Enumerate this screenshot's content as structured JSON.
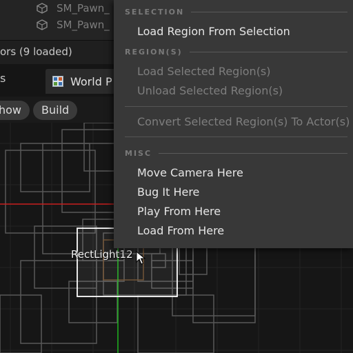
{
  "outliner": {
    "rows": [
      {
        "label": "SM_Pawn_",
        "icon": "static-mesh-icon"
      },
      {
        "label": "SM_Pawn_",
        "icon": "static-mesh-icon"
      }
    ]
  },
  "panel": {
    "title": "ors (9 loaded)"
  },
  "tabs": {
    "left_label": "s",
    "world_label": "World P"
  },
  "toolbar": {
    "show_label": "how",
    "build_label": "Build"
  },
  "viewport": {
    "actor_label": "RectLight12"
  },
  "context_menu": {
    "sections": {
      "selection": "SELECTION",
      "regions": "REGION(S)",
      "misc": "MISC"
    },
    "items": {
      "load_region_from_selection": "Load Region From Selection",
      "load_selected_regions": "Load Selected Region(s)",
      "unload_selected_regions": "Unload Selected Region(s)",
      "convert_selected_regions": "Convert Selected Region(s) To Actor(s)",
      "move_camera_here": "Move Camera Here",
      "bug_it_here": "Bug It Here",
      "play_from_here": "Play From Here",
      "load_from_here": "Load From Here"
    }
  },
  "colors": {
    "menu_bg": "#383838",
    "enabled_text": "#e6e6e6",
    "disabled_text": "#7e7e7e",
    "x_axis": "#c81e1e",
    "y_axis": "#1fb51f",
    "selection_box": "#ffffff"
  }
}
